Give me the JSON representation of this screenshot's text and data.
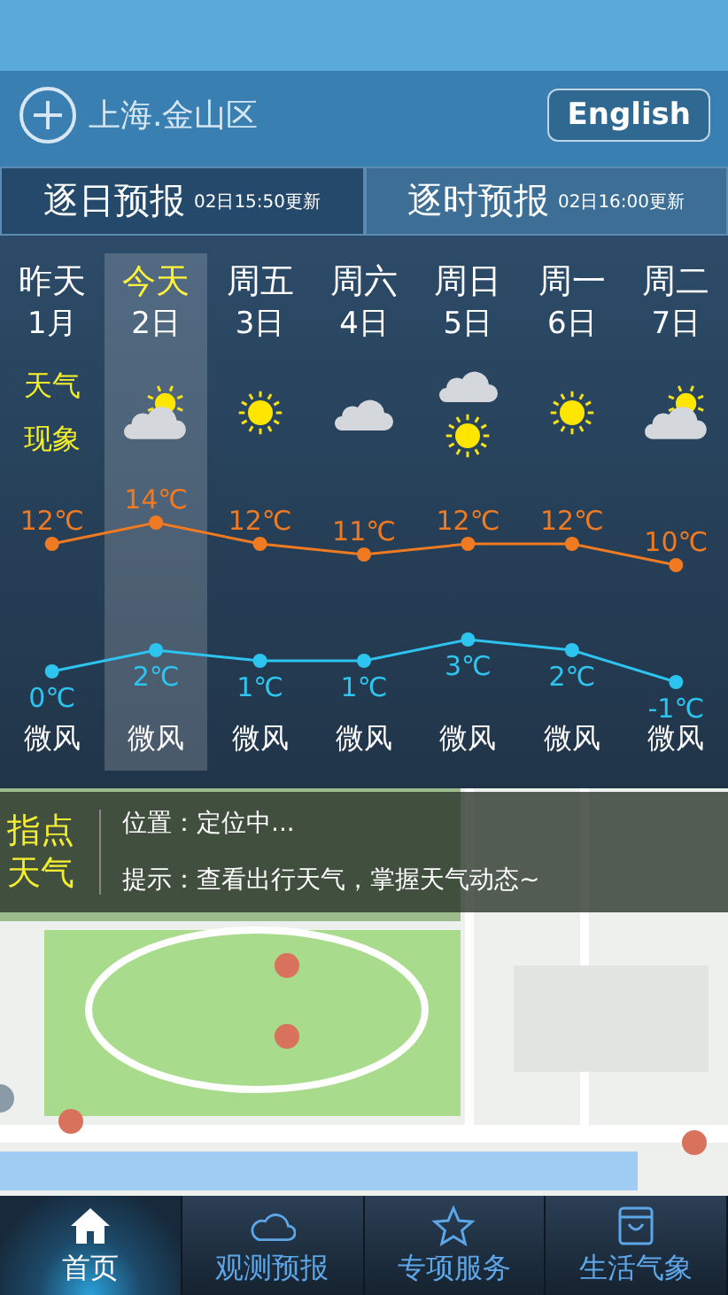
{
  "header": {
    "city": "上海.金山区",
    "language_button": "English"
  },
  "tabs": [
    {
      "title": "逐日预报",
      "updated": "02日15:50更新",
      "selected": true
    },
    {
      "title": "逐时预报",
      "updated": "02日16:00更新",
      "selected": false
    }
  ],
  "forecast": {
    "weather_label": [
      "天气",
      "现象"
    ],
    "days": [
      {
        "name": "昨天",
        "date": "1月",
        "kind": "label",
        "wind": "微风",
        "selected": false
      },
      {
        "name": "今天",
        "date": "2日",
        "kind": "partly-cloudy",
        "wind": "微风",
        "selected": true
      },
      {
        "name": "周五",
        "date": "3日",
        "kind": "sunny",
        "wind": "微风",
        "selected": false
      },
      {
        "name": "周六",
        "date": "4日",
        "kind": "cloudy",
        "wind": "微风",
        "selected": false
      },
      {
        "name": "周日",
        "date": "5日",
        "kind": "cloudy-then-sunny",
        "wind": "微风",
        "selected": false
      },
      {
        "name": "周一",
        "date": "6日",
        "kind": "sunny",
        "wind": "微风",
        "selected": false
      },
      {
        "name": "周二",
        "date": "7日",
        "kind": "partly-cloudy",
        "wind": "微风",
        "selected": false
      }
    ],
    "chart_data": {
      "type": "line",
      "categories": [
        null,
        null,
        null,
        null,
        null,
        null,
        null
      ],
      "data_labels": true,
      "series": [
        {
          "color": "#f07a22",
          "marker": "circle",
          "values": [
            12,
            14,
            12,
            11,
            12,
            12,
            10
          ],
          "value_labels": [
            "12℃",
            "14℃",
            "12℃",
            "11℃",
            "12℃",
            "12℃",
            "10℃"
          ]
        },
        {
          "color": "#2ec4f0",
          "marker": "circle",
          "values": [
            0,
            2,
            1,
            1,
            3,
            2,
            -1
          ],
          "value_labels": [
            "0℃",
            "2℃",
            "1℃",
            "1℃",
            "3℃",
            "2℃",
            "-1℃"
          ]
        }
      ]
    }
  },
  "map": {
    "kind": "picture",
    "panel": {
      "title": "指点天气",
      "location": "位置：定位中...",
      "hint": "提示：查看出行天气，掌握天气动态~"
    }
  },
  "nav": [
    {
      "label": "首页",
      "kind": "home",
      "selected": true
    },
    {
      "label": "观测预报",
      "kind": "cloud",
      "selected": false
    },
    {
      "label": "专项服务",
      "kind": "star",
      "selected": false
    },
    {
      "label": "生活气象",
      "kind": "bag",
      "selected": false
    }
  ]
}
